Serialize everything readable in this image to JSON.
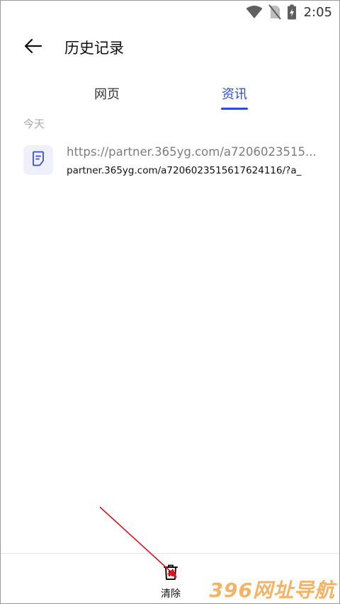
{
  "status_bar": {
    "time": "2:05",
    "icons": [
      "wifi-icon",
      "no-sim-icon",
      "battery-charging-icon"
    ]
  },
  "header": {
    "title": "历史记录",
    "back_icon": "arrow-left-icon"
  },
  "tabs": [
    {
      "label": "网页",
      "selected": false
    },
    {
      "label": "资讯",
      "selected": true
    }
  ],
  "colors": {
    "accent": "#2d4bd8",
    "secondary_text": "#7d7d7d",
    "section_label": "#a8a8a8",
    "annotation_arrow": "#e0141c",
    "watermark": "#f3a64a"
  },
  "history": {
    "section_label": "今天",
    "items": [
      {
        "icon": "document-icon",
        "title": "https://partner.365yg.com/a7206023515...",
        "url": "partner.365yg.com/a7206023515617624116/?a_"
      }
    ]
  },
  "bottom_bar": {
    "clear_label": "清除",
    "clear_icon": "trash-icon"
  },
  "watermark": "396网址导航"
}
